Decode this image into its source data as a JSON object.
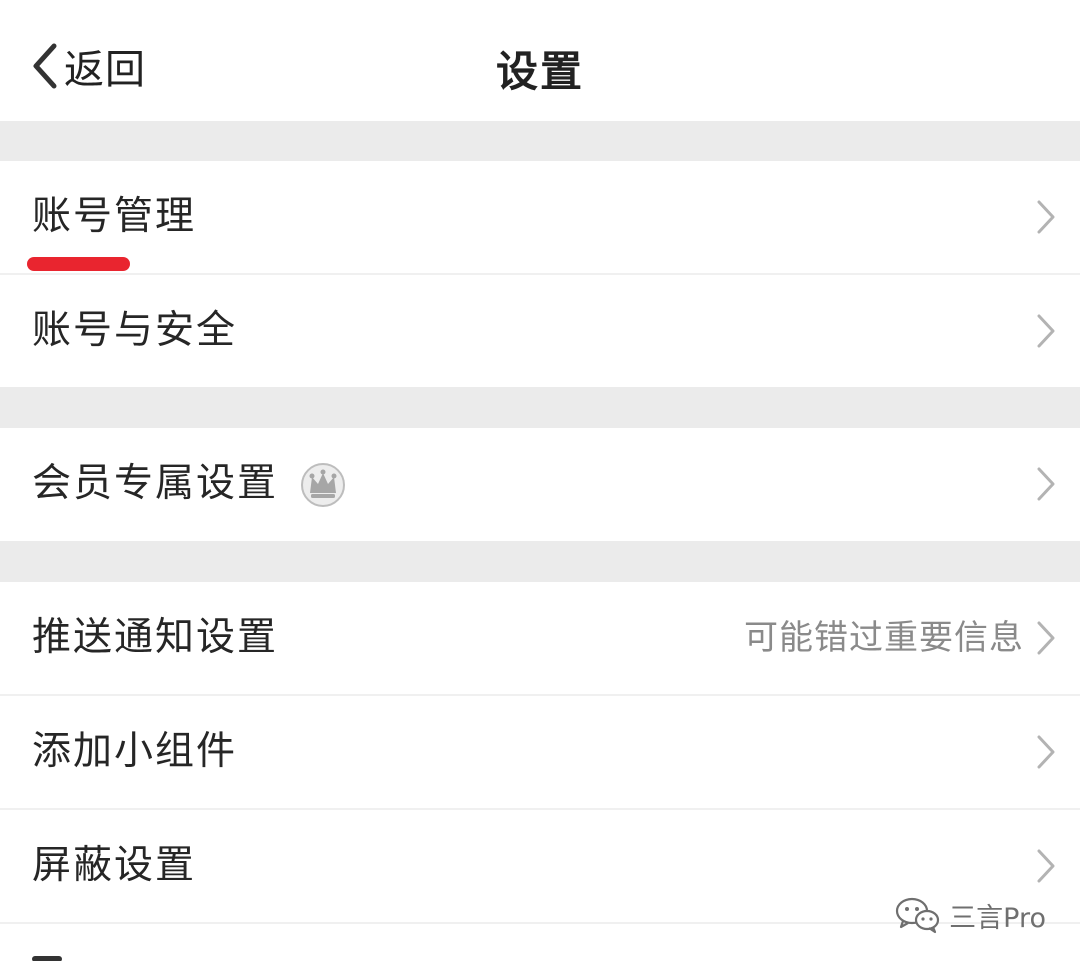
{
  "navbar": {
    "back_label": "返回",
    "title": "设置"
  },
  "settings": {
    "account_management": "账号管理",
    "account_security": "账号与安全",
    "member_settings": "会员专属设置",
    "push_settings": "推送通知设置",
    "push_hint": "可能错过重要信息",
    "add_widget": "添加小组件",
    "block_settings": "屏蔽设置"
  },
  "watermark": {
    "text": "三言Pro"
  },
  "icons": {
    "back": "chevron-left-icon",
    "row_arrow": "chevron-right-icon",
    "member": "crown-icon",
    "watermark": "wechat-icon"
  },
  "colors": {
    "highlight_underline": "#e9252f",
    "section_gap": "#ebebeb",
    "secondary_text": "#8a8a8a"
  }
}
